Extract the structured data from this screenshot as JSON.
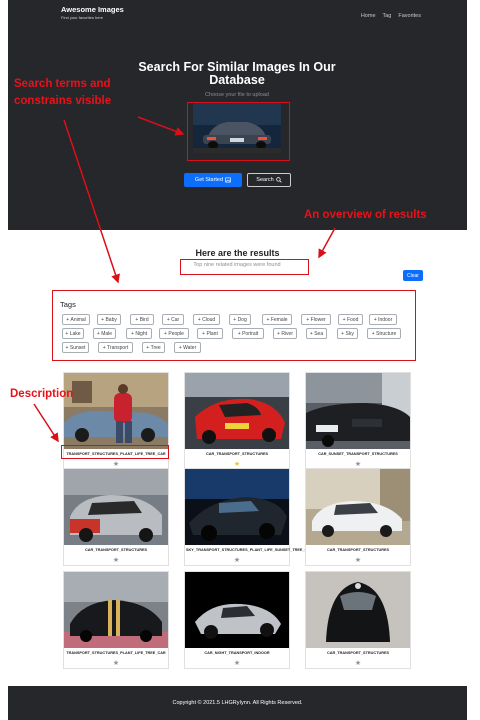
{
  "header": {
    "brand_name": "Awesome Images",
    "brand_tagline": "Find your favorites here",
    "nav": [
      "Home",
      "Tag",
      "Favorites"
    ]
  },
  "hero": {
    "title": "Search For Similar Images In Our Database",
    "subtitle": "Choose your file to upload",
    "get_started_label": "Get Started",
    "search_label": "Search"
  },
  "results": {
    "title": "Here are the results",
    "subtitle": "Top nine related images were found",
    "clear_label": "Clear"
  },
  "tags": {
    "heading": "Tags",
    "items": [
      "Animal",
      "Baby",
      "Bird",
      "Car",
      "Cloud",
      "Dog",
      "Female",
      "Flower",
      "Food",
      "Indoor",
      "Lake",
      "Male",
      "Night",
      "People",
      "Plant",
      "Portrait",
      "River",
      "Sea",
      "Sky",
      "Structure",
      "Sunset",
      "Transport",
      "Tree",
      "Water"
    ]
  },
  "cards": [
    {
      "caption": "TRANSPORT_STRUCTURES_PLANT_LIFE_TREE_CAR",
      "favorite": false
    },
    {
      "caption": "CAR_TRANSPORT_STRUCTURES",
      "favorite": true
    },
    {
      "caption": "CAR_SUNSET_TRANSPORT_STRUCTURES",
      "favorite": false
    },
    {
      "caption": "CAR_TRANSPORT_STRUCTURES",
      "favorite": false
    },
    {
      "caption": "SKY_TRANSPORT_STRUCTURES_PLANT_LIFE_SUNSET_TREE_CAR",
      "favorite": false
    },
    {
      "caption": "CAR_TRANSPORT_STRUCTURES",
      "favorite": false
    },
    {
      "caption": "TRANSPORT_STRUCTURES_PLANT_LIFE_TREE_CAR",
      "favorite": false
    },
    {
      "caption": "CAR_NIGHT_TRANSPORT_INDOOR",
      "favorite": false
    },
    {
      "caption": "CAR_TRANSPORT_STRUCTURES",
      "favorite": false
    }
  ],
  "footer": {
    "copyright": "Copyright © 2021.5 LHGRyIynn. All Rights Reserved."
  },
  "annotations": {
    "search_terms": "Search terms and constrains visible",
    "overview": "An overview of results",
    "description": "Description"
  },
  "icons": {
    "upload": "image-icon",
    "search": "search-icon",
    "favorite": "star-icon"
  },
  "colors": {
    "hero_bg": "#25272b",
    "primary": "#0d6efd",
    "annotation": "#e8121a",
    "star_on": "#f5c518",
    "star_off": "#8e9399"
  }
}
